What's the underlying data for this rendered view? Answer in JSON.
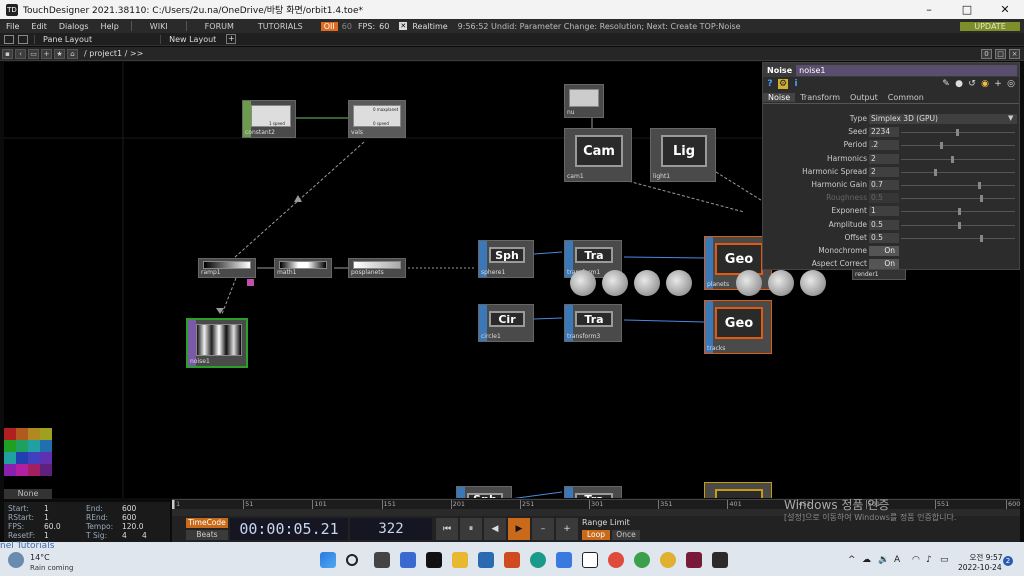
{
  "window": {
    "title": "TouchDesigner 2021.38110: C:/Users/2u.na/OneDrive/바탕 화면/orbit1.4.toe*",
    "app_icon": "TD"
  },
  "menu": {
    "items": [
      "File",
      "Edit",
      "Dialogs",
      "Help"
    ],
    "links": [
      "WIKI",
      "FORUM",
      "TUTORIALS"
    ],
    "op_label": "OII",
    "fps_dim": "60",
    "fps_label": "FPS:",
    "fps_value": "60",
    "realtime_label": "Realtime",
    "realtime_check": "✕",
    "status": "9:56:52 Undid: Parameter Change: Resolution; Next: Create TOP:Noise",
    "update_label": "UPDATE"
  },
  "panes": {
    "pane_layout": "Pane Layout",
    "new_layout": "New Layout",
    "plus": "+"
  },
  "pathbar": {
    "path": "/ project1 / >>",
    "right_buttons": [
      "0",
      "□"
    ]
  },
  "nodes": {
    "constant2": "constant2",
    "vals": "vals",
    "vals_line1": "0 maxplanet",
    "vals_line2": "0 speed",
    "constant_line": "1 speed",
    "ramp1": "ramp1",
    "math1": "math1",
    "posplanets": "posplanets",
    "noise1": "noise1",
    "null": "nu",
    "cam1": "cam1",
    "cam_text": "Cam",
    "light1": "light1",
    "light_text": "Lig",
    "sphere1": "sphere1",
    "sph_text": "Sph",
    "transform1": "transform1",
    "tra_text": "Tra",
    "planets": "planets",
    "geo_text": "Geo",
    "circle1": "circle1",
    "cir_text": "Cir",
    "transform3": "transform3",
    "tracks": "tracks",
    "render1": "render1"
  },
  "palette": {
    "none_label": "None",
    "colors": [
      "#b02020",
      "#b05a20",
      "#b08a20",
      "#a0a020",
      "#20a020",
      "#20a060",
      "#2070b0",
      "#2040b0",
      "#8a20b0",
      "#b020a0",
      "#a02060",
      "#602080"
    ]
  },
  "params": {
    "op_type": "Noise",
    "op_name": "noise1",
    "tabs": [
      "Noise",
      "Transform",
      "Output",
      "Common"
    ],
    "rows": [
      {
        "label": "Type",
        "value": "Simplex 3D (GPU)",
        "kind": "menu"
      },
      {
        "label": "Seed",
        "value": "2234",
        "kind": "num",
        "knob": 0.5
      },
      {
        "label": "Period",
        "value": ".2",
        "kind": "num",
        "knob": 0.35
      },
      {
        "label": "Harmonics",
        "value": "2",
        "kind": "num",
        "knob": 0.45
      },
      {
        "label": "Harmonic Spread",
        "value": "2",
        "kind": "num",
        "knob": 0.3
      },
      {
        "label": "Harmonic Gain",
        "value": "0.7",
        "kind": "num",
        "knob": 0.7
      },
      {
        "label": "Roughness",
        "value": "0.5",
        "kind": "dim",
        "knob": 0.72
      },
      {
        "label": "Exponent",
        "value": "1",
        "kind": "num",
        "knob": 0.52
      },
      {
        "label": "Amplitude",
        "value": "0.5",
        "kind": "num",
        "knob": 0.52
      },
      {
        "label": "Offset",
        "value": "0.5",
        "kind": "num",
        "knob": 0.72
      },
      {
        "label": "Monochrome",
        "value": "On",
        "kind": "toggle"
      },
      {
        "label": "Aspect Correct",
        "value": "On",
        "kind": "toggle"
      }
    ]
  },
  "timeline": {
    "ticks": [
      "1",
      "51",
      "101",
      "151",
      "201",
      "251",
      "301",
      "351",
      "401",
      "451",
      "501",
      "551",
      "600"
    ],
    "start_label": "Start:",
    "start_value": "1",
    "rstart_label": "RStart:",
    "rstart_value": "1",
    "fps_label": "FPS:",
    "fps_value": "60.0",
    "resetf_label": "ResetF:",
    "resetf_value": "1",
    "end_label": "End:",
    "end_value": "600",
    "rend_label": "REnd:",
    "rend_value": "600",
    "tempo_label": "Tempo:",
    "tempo_value": "120.0",
    "tsig_label": "T Sig:",
    "tsig_a": "4",
    "tsig_b": "4",
    "timecode_label": "TimeCode",
    "beats_label": "Beats",
    "clock": "00:00:05.21",
    "frame": "322",
    "range_label": "Range Limit",
    "loop_label": "Loop",
    "once_label": "Once"
  },
  "watermark": {
    "line1": "Windows 정품 인증",
    "line2": "[설정]으로 이동하여 Windows를 정품 인증합니다."
  },
  "taskbar": {
    "weather_temp": "14°C",
    "weather_desc": "Rain coming",
    "under_text": "nel Tutorials",
    "time": "오전 9:57",
    "date": "2022-10-24",
    "tray_lang": "A",
    "notif_count": "2"
  }
}
